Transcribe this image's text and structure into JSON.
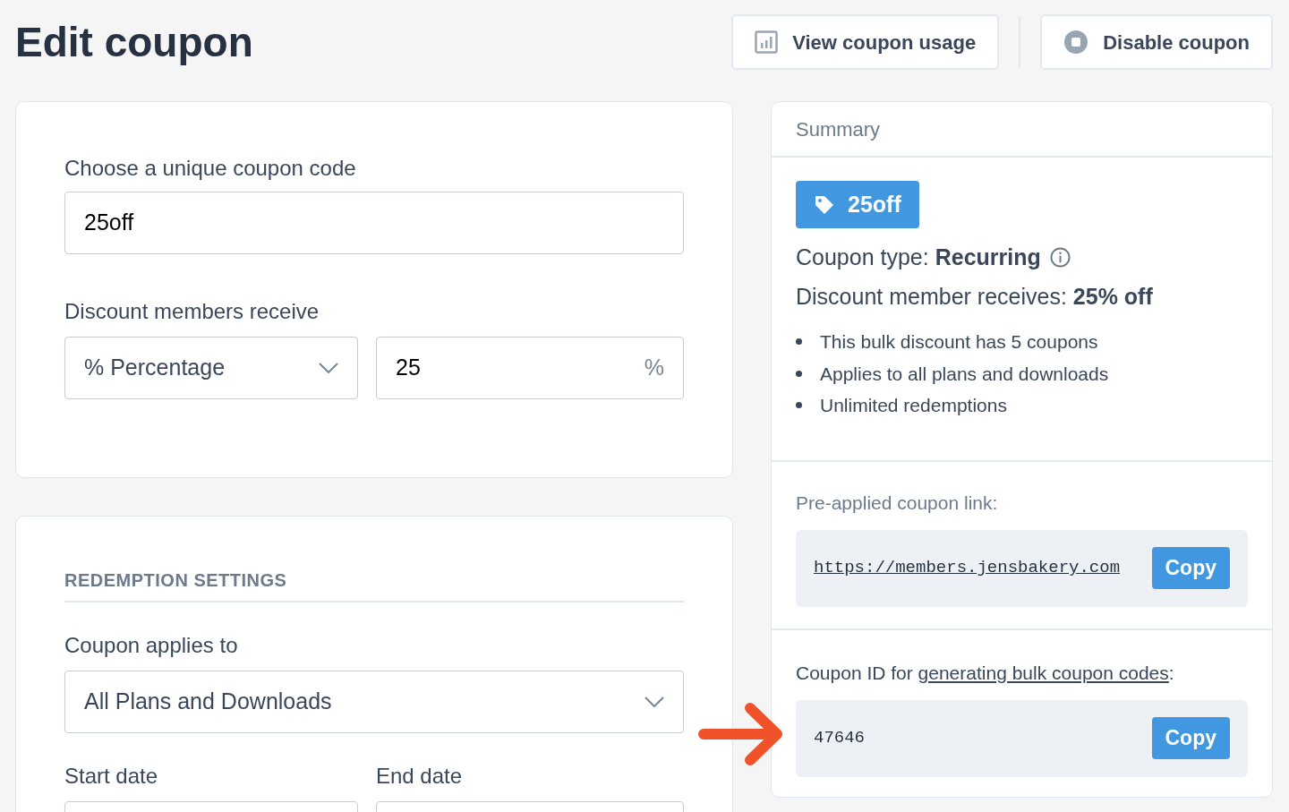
{
  "page": {
    "title": "Edit coupon"
  },
  "header_buttons": [
    {
      "kind": "chart",
      "label": "View coupon usage"
    },
    {
      "kind": "stop",
      "label": "Disable coupon"
    }
  ],
  "coupon_card": {
    "code_label": "Choose a unique coupon code",
    "code_value": "25off",
    "discount_label": "Discount members receive",
    "discount_type": "% Percentage",
    "discount_amount": "25",
    "discount_suffix": "%"
  },
  "redemption_card": {
    "heading": "REDEMPTION SETTINGS",
    "applies_label": "Coupon applies to",
    "applies_value": "All Plans and Downloads",
    "start_label": "Start date",
    "end_label": "End date"
  },
  "summary": {
    "title": "Summary",
    "badge": "25off",
    "type_text": "Coupon type: **Recurring**",
    "discount_text": "Discount member receives: **25% off**",
    "bullets": [
      "This bulk discount has 5 coupons",
      "Applies to all plans and downloads",
      "Unlimited redemptions"
    ],
    "link_label": "Pre-applied coupon link:",
    "link_value": "https://members.jensbakery.com",
    "link_copy": "Copy",
    "id_label_before": "Coupon ID for ",
    "id_label_link": "generating bulk coupon codes",
    "id_label_after": ":",
    "id_value": "47646",
    "id_copy": "Copy"
  }
}
